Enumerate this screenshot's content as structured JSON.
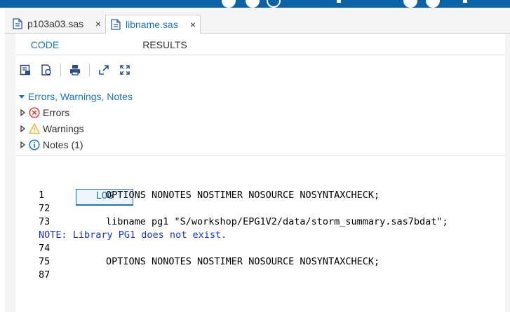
{
  "file_tabs": [
    {
      "label": "p103a03.sas",
      "active": false,
      "close": "×",
      "icon": "sas-file-icon"
    },
    {
      "label": "libname.sas",
      "active": true,
      "close": "×",
      "icon": "sas-file-icon"
    }
  ],
  "subtabs": {
    "code": "CODE",
    "log": "LOG",
    "results": "RESULTS",
    "selected": "LOG"
  },
  "toolbar": [
    "save-log-icon",
    "save-pdf-icon",
    "print-icon",
    "popout-icon",
    "maximize-icon"
  ],
  "summary": {
    "header": "Errors, Warnings, Notes",
    "errors": "Errors",
    "warnings": "Warnings",
    "notes": "Notes (1)"
  },
  "log_lines": [
    {
      "num": "1",
      "text": "OPTIONS NONOTES NOSTIMER NOSOURCE NOSYNTAXCHECK;"
    },
    {
      "num": "72",
      "text": ""
    },
    {
      "num": "73",
      "text": "libname pg1 \"S/workshop/EPG1V2/data/storm_summary.sas7bdat\";"
    },
    {
      "note": "NOTE: Library PG1 does not exist."
    },
    {
      "num": "74",
      "text": ""
    },
    {
      "num": "75",
      "text": "OPTIONS NONOTES NOSTIMER NOSOURCE NOSYNTAXCHECK;"
    },
    {
      "num": "87",
      "text": ""
    }
  ],
  "colors": {
    "accent": "#1f74b7",
    "note": "#1b35c4",
    "error": "#e0403a",
    "warning": "#f0b43c",
    "topbar": "#0b63a5"
  }
}
